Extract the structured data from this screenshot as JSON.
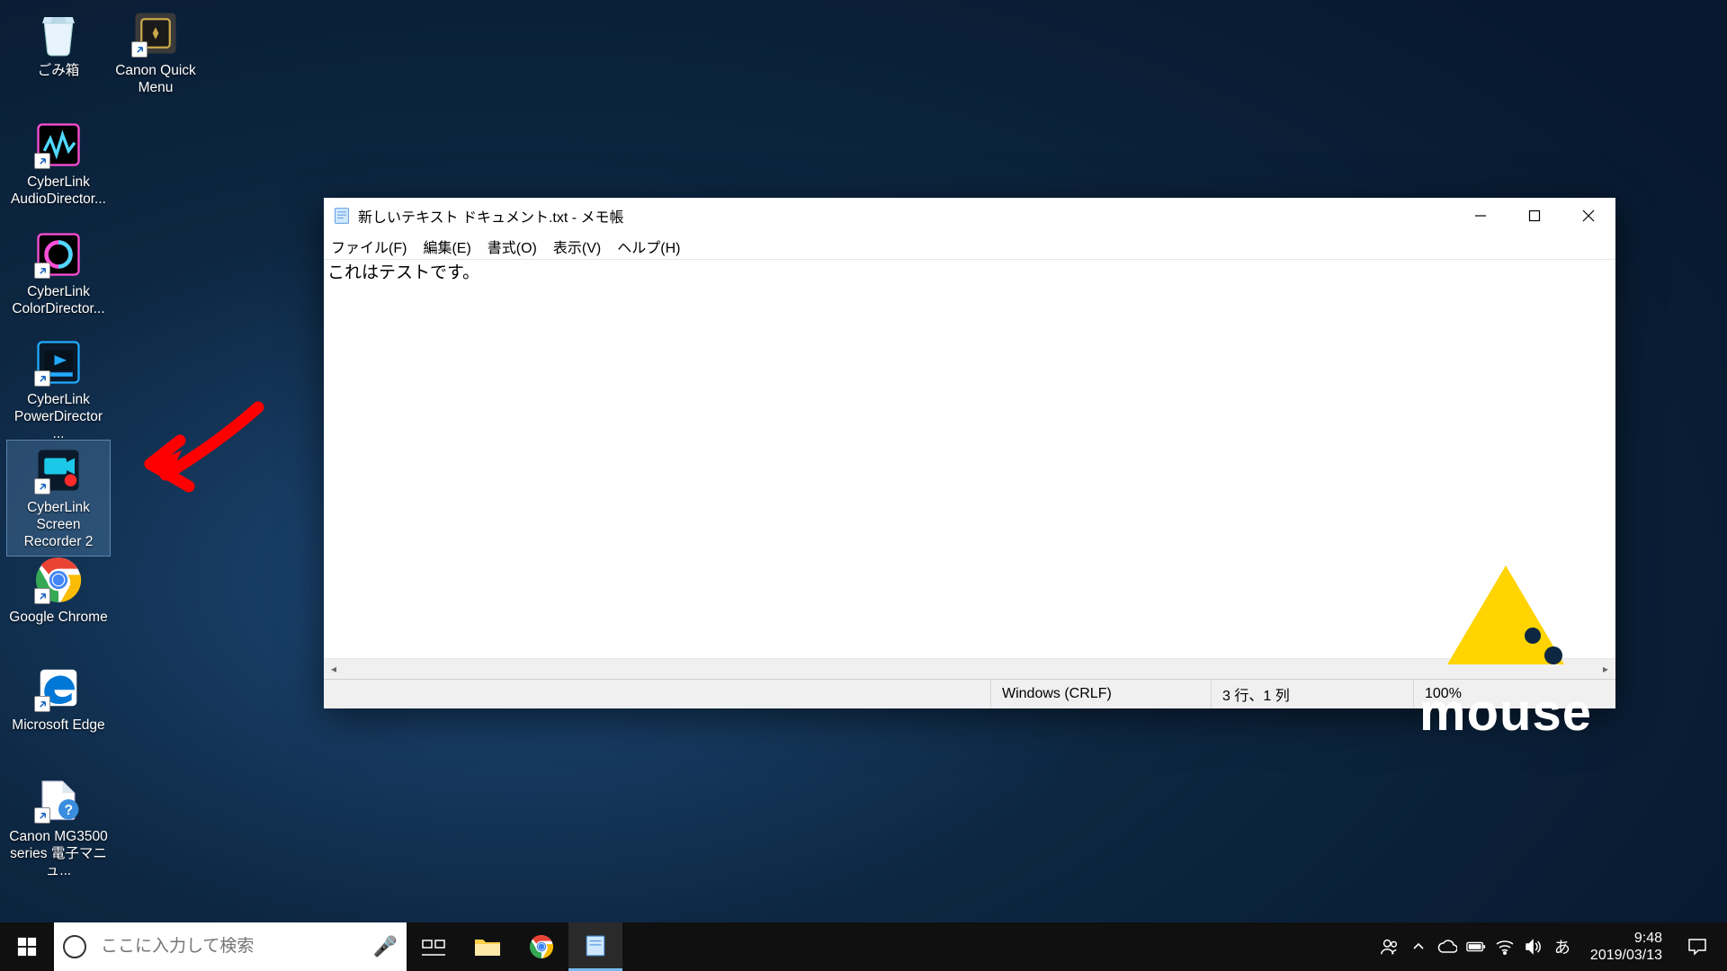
{
  "desktop_icons": [
    {
      "id": "i0",
      "label": "ごみ箱",
      "kind": "recycle",
      "shortcut": false
    },
    {
      "id": "i1",
      "label": "Canon Quick\nMenu",
      "kind": "canon",
      "shortcut": true
    },
    {
      "id": "i2",
      "label": "CyberLink\nAudioDirector...",
      "kind": "audiodir",
      "shortcut": true
    },
    {
      "id": "i3",
      "label": "CyberLink\nColorDirector...",
      "kind": "colordir",
      "shortcut": true
    },
    {
      "id": "i4",
      "label": "CyberLink\nPowerDirector ...",
      "kind": "powerdir",
      "shortcut": true
    },
    {
      "id": "i5",
      "label": "CyberLink Screen\nRecorder 2",
      "kind": "screenrec",
      "shortcut": true,
      "selected": true
    },
    {
      "id": "i6",
      "label": "Google Chrome",
      "kind": "chrome",
      "shortcut": true
    },
    {
      "id": "i7",
      "label": "Microsoft Edge",
      "kind": "edge",
      "shortcut": true
    },
    {
      "id": "i8",
      "label": "Canon MG3500\nseries 電子マニュ...",
      "kind": "canonman",
      "shortcut": true
    }
  ],
  "notepad": {
    "title": "新しいテキスト ドキュメント.txt - メモ帳",
    "menu": [
      "ファイル(F)",
      "編集(E)",
      "書式(O)",
      "表示(V)",
      "ヘルプ(H)"
    ],
    "content": "これはテストです。\n",
    "status": {
      "encoding": "Windows (CRLF)",
      "pos": "3 行、1 列",
      "zoom": "100%"
    }
  },
  "taskbar": {
    "search_placeholder": "ここに入力して検索",
    "clock": {
      "time": "9:48",
      "date": "2019/03/13"
    },
    "ime": "あ"
  },
  "brand": {
    "word": "mouse"
  }
}
